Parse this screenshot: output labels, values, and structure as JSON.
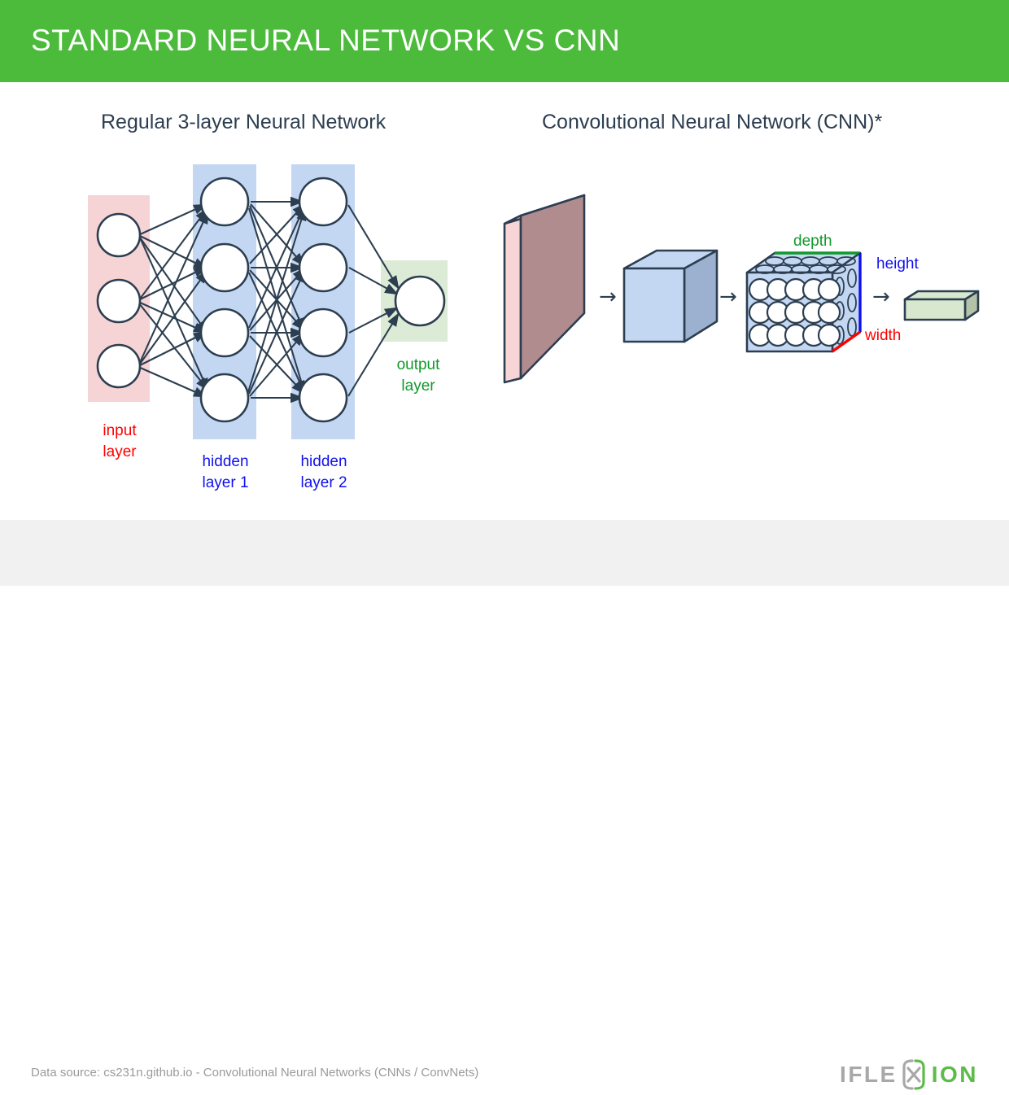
{
  "header": {
    "title": "STANDARD NEURAL NETWORK VS CNN",
    "background_color": "#4cbb3c",
    "text_color": "#ffffff"
  },
  "panels": {
    "left": {
      "title": "Regular 3-layer Neural Network",
      "layers": [
        {
          "name": "input layer",
          "label": "input\nlayer",
          "nodes": 3,
          "band_color": "#f6d3d4",
          "label_color": "#ff0000"
        },
        {
          "name": "hidden layer 1",
          "label": "hidden\nlayer 1",
          "nodes": 4,
          "band_color": "#c3d7f2",
          "label_color": "#1111ee"
        },
        {
          "name": "hidden layer 2",
          "label": "hidden\nlayer 2",
          "nodes": 4,
          "band_color": "#c3d7f2",
          "label_color": "#1111ee"
        },
        {
          "name": "output layer",
          "label": "output\nlayer",
          "nodes": 1,
          "band_color": "#dcebd5",
          "label_color": "#11992b"
        }
      ]
    },
    "right": {
      "title": "Convolutional Neural Network (CNN)*",
      "stages": [
        {
          "name": "input-slab",
          "fill": "#b08c8f",
          "side_fill": "#f6d3d4"
        },
        {
          "name": "conv-cube",
          "fill": "#c3d7f2",
          "side_fill": "#9cb0cf"
        },
        {
          "name": "neuron-cube",
          "fill": "#c3d7f2",
          "side_fill": "#9cb0cf",
          "circle_columns": 5,
          "circle_rows": 3
        },
        {
          "name": "output-bar",
          "fill": "#d8e8cf",
          "side_fill": "#b4c2a8"
        }
      ],
      "dimension_labels": [
        {
          "text": "depth",
          "color": "#11992b"
        },
        {
          "text": "height",
          "color": "#1111ee"
        },
        {
          "text": "width",
          "color": "#ff0000"
        }
      ],
      "arrow": "→"
    }
  },
  "footer": {
    "source_text": "Data source: cs231n.github.io - Convolutional Neural Networks (CNNs / ConvNets)",
    "logo": {
      "part1": "IFLE",
      "part2": "ION",
      "symbol": "X",
      "color1": "#a8a8a8",
      "color2": "#5cbb4a"
    },
    "background_color": "#f1f1f1"
  }
}
